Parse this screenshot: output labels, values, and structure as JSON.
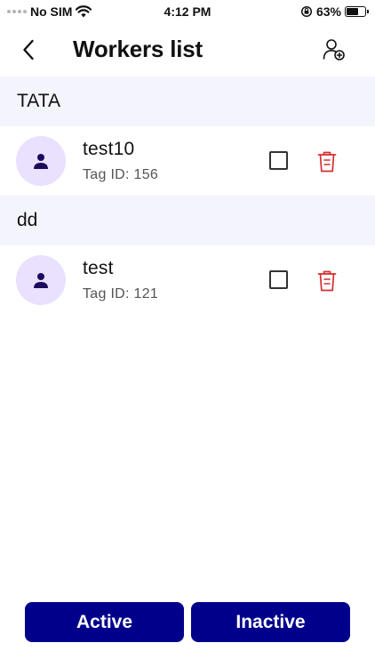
{
  "status_bar": {
    "carrier": "No SIM",
    "time": "4:12 PM",
    "battery_percent": "63%",
    "battery_level": 0.63
  },
  "header": {
    "title": "Workers list",
    "back_icon": "chevron-left-icon",
    "add_icon": "add-user-icon"
  },
  "groups": [
    {
      "name": "TATA",
      "workers": [
        {
          "name": "test10",
          "tag": "Tag ID: 156",
          "checked": false
        }
      ]
    },
    {
      "name": "dd",
      "workers": [
        {
          "name": "test",
          "tag": "Tag ID: 121",
          "checked": false
        }
      ]
    }
  ],
  "footer": {
    "active_label": "Active",
    "inactive_label": "Inactive"
  },
  "colors": {
    "primary": "#00008b",
    "group_bg": "#f4f4fd",
    "avatar_bg": "#eae0ff",
    "avatar_icon": "#1e0a5c",
    "delete": "#d32f2f"
  }
}
